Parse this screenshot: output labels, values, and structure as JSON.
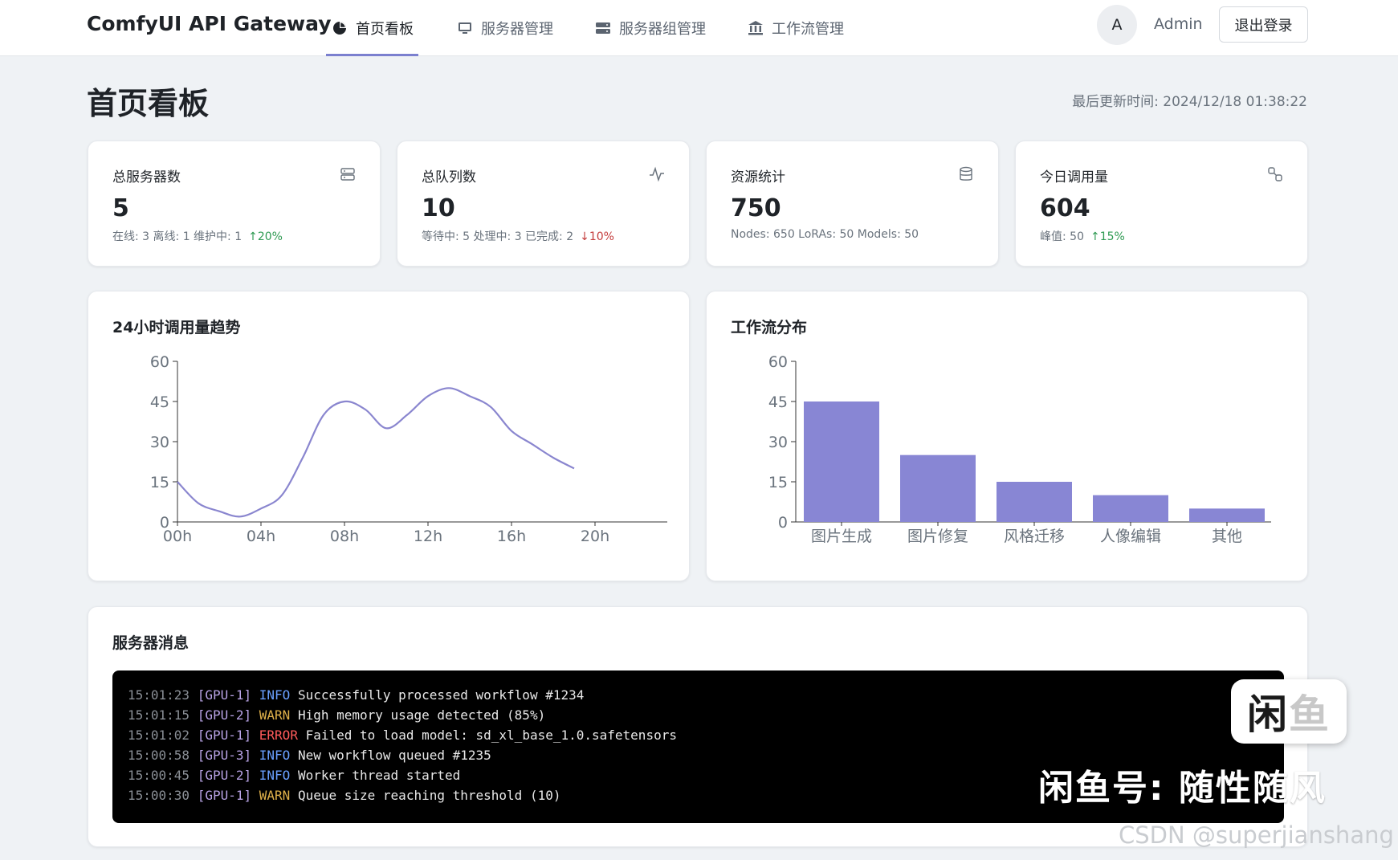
{
  "header": {
    "brand": "ComfyUI API Gateway",
    "nav": [
      {
        "label": "首页看板",
        "icon": "pie-chart-icon",
        "active": true
      },
      {
        "label": "服务器管理",
        "icon": "monitor-icon",
        "active": false
      },
      {
        "label": "服务器组管理",
        "icon": "server-icon",
        "active": false
      },
      {
        "label": "工作流管理",
        "icon": "bank-icon",
        "active": false
      }
    ],
    "avatar_letter": "A",
    "username": "Admin",
    "logout_label": "退出登录"
  },
  "page": {
    "title": "首页看板",
    "updated": "最后更新时间: 2024/12/18 01:38:22"
  },
  "stats": [
    {
      "label": "总服务器数",
      "icon": "server-icon",
      "value": "5",
      "sub": "在线: 3 离线: 1 维护中: 1",
      "trend": "↑20%",
      "trend_dir": "up"
    },
    {
      "label": "总队列数",
      "icon": "activity-icon",
      "value": "10",
      "sub": "等待中: 5 处理中: 3 已完成: 2",
      "trend": "↓10%",
      "trend_dir": "down"
    },
    {
      "label": "资源统计",
      "icon": "database-icon",
      "value": "750",
      "sub": "Nodes: 650 LoRAs: 50 Models: 50",
      "trend": "",
      "trend_dir": ""
    },
    {
      "label": "今日调用量",
      "icon": "link-icon",
      "value": "604",
      "sub": "峰值: 50",
      "trend": "↑15%",
      "trend_dir": "up"
    }
  ],
  "line_card": {
    "title": "24小时调用量趋势"
  },
  "bar_card": {
    "title": "工作流分布"
  },
  "chart_data": [
    {
      "type": "line",
      "title": "24小时调用量趋势",
      "x_ticks": [
        "00h",
        "04h",
        "08h",
        "12h",
        "16h",
        "20h"
      ],
      "x": [
        0,
        1,
        2,
        3,
        4,
        5,
        6,
        7,
        8,
        9,
        10,
        11,
        12,
        13,
        14,
        15,
        16,
        17,
        18,
        19,
        20,
        21
      ],
      "values": [
        15,
        7,
        4,
        2,
        5,
        10,
        24,
        40,
        45,
        42,
        35,
        40,
        47,
        50,
        47,
        43,
        34,
        29,
        24,
        20
      ],
      "ylim": [
        0,
        60
      ],
      "y_ticks": [
        0,
        15,
        30,
        45,
        60
      ],
      "color": "#8a86cf"
    },
    {
      "type": "bar",
      "title": "工作流分布",
      "categories": [
        "图片生成",
        "图片修复",
        "风格迁移",
        "人像编辑",
        "其他"
      ],
      "values": [
        45,
        25,
        15,
        10,
        5
      ],
      "ylim": [
        0,
        60
      ],
      "y_ticks": [
        0,
        15,
        30,
        45,
        60
      ],
      "color": "#8886d4"
    }
  ],
  "logs_card": {
    "title": "服务器消息",
    "lines": [
      {
        "time": "15:01:23",
        "source": "[GPU-1]",
        "level": "INFO",
        "message": "Successfully processed workflow #1234"
      },
      {
        "time": "15:01:15",
        "source": "[GPU-2]",
        "level": "WARN",
        "message": "High memory usage detected (85%)"
      },
      {
        "time": "15:01:02",
        "source": "[GPU-1]",
        "level": "ERROR",
        "message": "Failed to load model: sd_xl_base_1.0.safetensors"
      },
      {
        "time": "15:00:58",
        "source": "[GPU-3]",
        "level": "INFO",
        "message": "New workflow queued #1235"
      },
      {
        "time": "15:00:45",
        "source": "[GPU-2]",
        "level": "INFO",
        "message": "Worker thread started"
      },
      {
        "time": "15:00:30",
        "source": "[GPU-1]",
        "level": "WARN",
        "message": "Queue size reaching threshold (10)"
      }
    ]
  },
  "watermark": {
    "badge_main": "闲",
    "badge_faded": "鱼",
    "text": "闲鱼号:  随性随风",
    "csdn": "CSDN @superjianshang"
  }
}
